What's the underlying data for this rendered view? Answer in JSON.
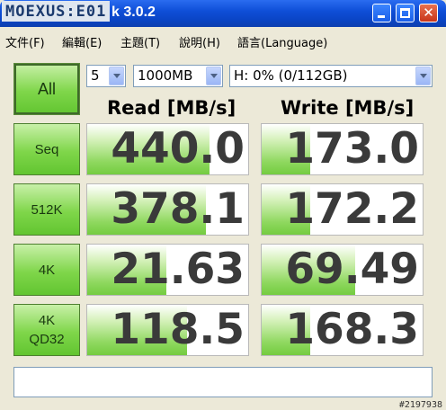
{
  "window": {
    "logo_text": "MOEXUS:E01",
    "title": "k 3.0.2"
  },
  "menu": {
    "items": [
      "文件(F)",
      "編輯(E)",
      "主題(T)",
      "說明(H)",
      "語言(Language)"
    ]
  },
  "controls": {
    "all_label": "All",
    "count": "5",
    "size": "1000MB",
    "drive": "H: 0% (0/112GB)"
  },
  "columns": {
    "read": "Read [MB/s]",
    "write": "Write [MB/s]"
  },
  "rows": [
    {
      "label_line1": "Seq",
      "label_line2": "",
      "read": "440.0",
      "write": "173.0",
      "read_level": 0.76,
      "write_level": 0.3
    },
    {
      "label_line1": "512K",
      "label_line2": "",
      "read": "378.1",
      "write": "172.2",
      "read_level": 0.74,
      "write_level": 0.3
    },
    {
      "label_line1": "4K",
      "label_line2": "",
      "read": "21.63",
      "write": "69.49",
      "read_level": 0.49,
      "write_level": 0.58
    },
    {
      "label_line1": "4K",
      "label_line2": "QD32",
      "read": "118.5",
      "write": "168.3",
      "read_level": 0.62,
      "write_level": 0.3
    }
  ],
  "watermark": "#2197938"
}
